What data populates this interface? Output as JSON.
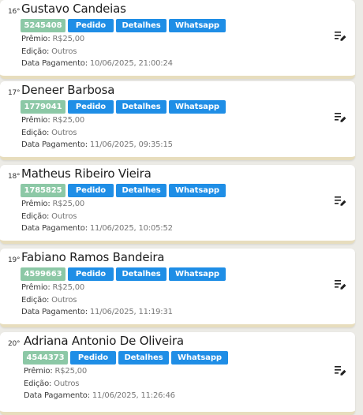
{
  "labels": {
    "premio": "Prêmio:",
    "edicao": "Edição:",
    "data_pagamento": "Data Pagamento:",
    "pedido": "Pedido",
    "detalhes": "Detalhes",
    "whatsapp": "Whatsapp"
  },
  "colors": {
    "code_badge": "#8cc8a6",
    "action_button": "#1f8ee6",
    "card_border": "#e7ddbd"
  },
  "entries": [
    {
      "rank": "16°",
      "name": "Gustavo Candeias",
      "code": "5245408",
      "premio": "R$25,00",
      "edicao": "Outros",
      "data_pagamento": "10/06/2025, 21:00:24",
      "action_icon": "edit-list-icon"
    },
    {
      "rank": "17°",
      "name": "Deneer Barbosa",
      "code": "1779041",
      "premio": "R$25,00",
      "edicao": "Outros",
      "data_pagamento": "11/06/2025, 09:35:15",
      "action_icon": "edit-list-icon"
    },
    {
      "rank": "18°",
      "name": "Matheus Ribeiro Vieira",
      "code": "1785825",
      "premio": "R$25,00",
      "edicao": "Outros",
      "data_pagamento": "11/06/2025, 10:05:52",
      "action_icon": "edit-list-icon"
    },
    {
      "rank": "19°",
      "name": "Fabiano Ramos Bandeira",
      "code": "4599663",
      "premio": "R$25,00",
      "edicao": "Outros",
      "data_pagamento": "11/06/2025, 11:19:31",
      "action_icon": "edit-list-icon"
    },
    {
      "rank": "20°",
      "name": "Adriana Antonio De Oliveira",
      "code": "4544373",
      "premio": "R$25,00",
      "edicao": "Outros",
      "data_pagamento": "11/06/2025, 11:26:46",
      "action_icon": "edit-list-icon"
    }
  ]
}
